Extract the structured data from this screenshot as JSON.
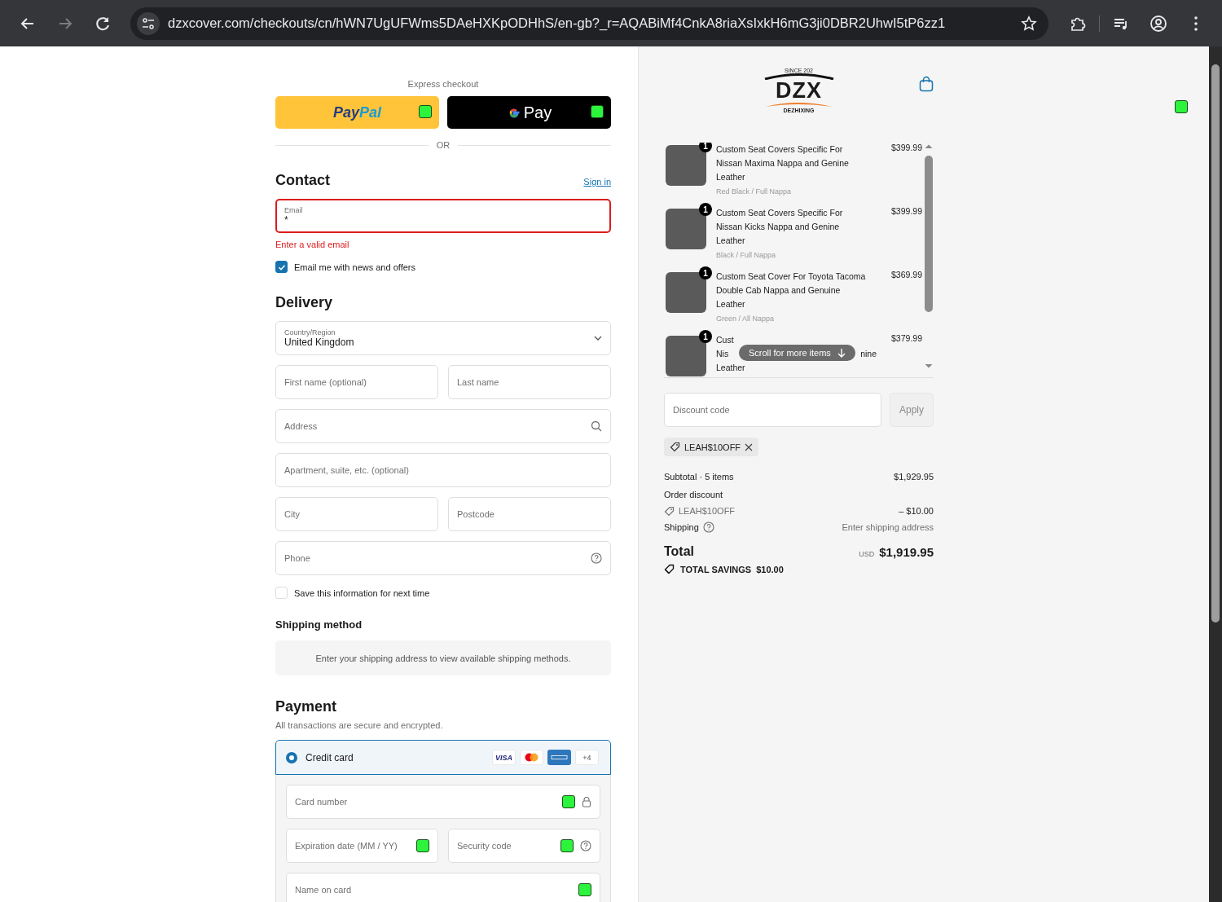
{
  "browser": {
    "url": "dzxcover.com/checkouts/cn/hWN7UgUFWms5DAeHXKpODHhS/en-gb?_r=AQABiMf4CnkA8riaXsIxkH6mG3ji0DBR2UhwI5tP6zz1",
    "forward_disabled": true
  },
  "express": {
    "label": "Express checkout",
    "buttons": [
      {
        "kind": "paypal",
        "parts": [
          "Pay",
          "Pal"
        ]
      },
      {
        "kind": "gpay",
        "parts": [
          "Pay"
        ]
      }
    ],
    "divider": "OR"
  },
  "contact": {
    "heading": "Contact",
    "sign_in": "Sign in",
    "email": {
      "label": "Email",
      "value": "*",
      "invalid": true
    },
    "error": "Enter a valid email",
    "newsletter": {
      "label": "Email me with news and offers",
      "checked": true
    }
  },
  "delivery": {
    "heading": "Delivery",
    "rows": [
      [
        {
          "kind": "select",
          "label": "Country/Region",
          "value": "United Kingdom"
        }
      ],
      [
        {
          "kind": "text",
          "placeholder": "First name (optional)"
        },
        {
          "kind": "text",
          "placeholder": "Last name"
        }
      ],
      [
        {
          "kind": "search",
          "placeholder": "Address"
        }
      ],
      [
        {
          "kind": "text",
          "placeholder": "Apartment, suite, etc. (optional)"
        }
      ],
      [
        {
          "kind": "text",
          "placeholder": "City"
        },
        {
          "kind": "text",
          "placeholder": "Postcode"
        }
      ],
      [
        {
          "kind": "help",
          "placeholder": "Phone"
        }
      ]
    ],
    "save_info": {
      "label": "Save this information for next time",
      "checked": false
    }
  },
  "shipping_method": {
    "heading": "Shipping method",
    "message": "Enter your shipping address to view available shipping methods."
  },
  "payment": {
    "heading": "Payment",
    "subtitle": "All transactions are secure and encrypted.",
    "methods": [
      {
        "label": "Credit card",
        "selected": true,
        "brands": [
          {
            "kind": "visa",
            "text": "VISA"
          },
          {
            "kind": "mastercard"
          },
          {
            "kind": "amex"
          },
          {
            "kind": "more",
            "text": "+4"
          }
        ],
        "fields": [
          [
            {
              "kind": "secure",
              "placeholder": "Card number"
            }
          ],
          [
            {
              "kind": "text",
              "placeholder": "Expiration date (MM / YY)"
            },
            {
              "kind": "help",
              "placeholder": "Security code"
            }
          ],
          [
            {
              "kind": "text",
              "placeholder": "Name on card"
            }
          ]
        ]
      }
    ]
  },
  "store": {
    "logo": {
      "tagline": "SINCE 202",
      "name": "DZX",
      "subtitle": "DEZHIXING"
    }
  },
  "cart_items": [
    {
      "quantity": "1",
      "title_lines": [
        "Custom Seat Covers Specific For",
        "Nissan Maxima Nappa and Genine",
        "Leather"
      ],
      "variant": "Red Black / Full Nappa",
      "price": "$399.99"
    },
    {
      "quantity": "1",
      "title_lines": [
        "Custom Seat Covers Specific For",
        "Nissan Kicks Nappa and Genine",
        "Leather"
      ],
      "variant": "Black / Full Nappa",
      "price": "$399.99"
    },
    {
      "quantity": "1",
      "title_lines": [
        "Custom Seat Cover For Toyota Tacoma",
        "Double Cab Nappa and Genuine",
        "Leather"
      ],
      "variant": "Green / All Nappa",
      "price": "$369.99"
    },
    {
      "quantity": "1",
      "title_lines": [
        "Cust",
        "Nis",
        "Leather"
      ],
      "hidden_tail": "nine",
      "price": "$379.99"
    }
  ],
  "scroll_hint": "Scroll for more items",
  "discount": {
    "placeholder": "Discount code",
    "apply": "Apply",
    "apply_disabled": true,
    "applied_code": "LEAH$10OFF"
  },
  "summary": {
    "subtotal_label": "Subtotal · 5 items",
    "subtotal": "$1,929.95",
    "discount_label": "Order discount",
    "discount_code": "LEAH$10OFF",
    "discount_value": "– $10.00",
    "shipping_label": "Shipping",
    "shipping_value": "Enter shipping address",
    "total_label": "Total",
    "currency": "USD",
    "total": "$1,919.95",
    "savings_label": "TOTAL SAVINGS",
    "savings": "$10.00"
  }
}
